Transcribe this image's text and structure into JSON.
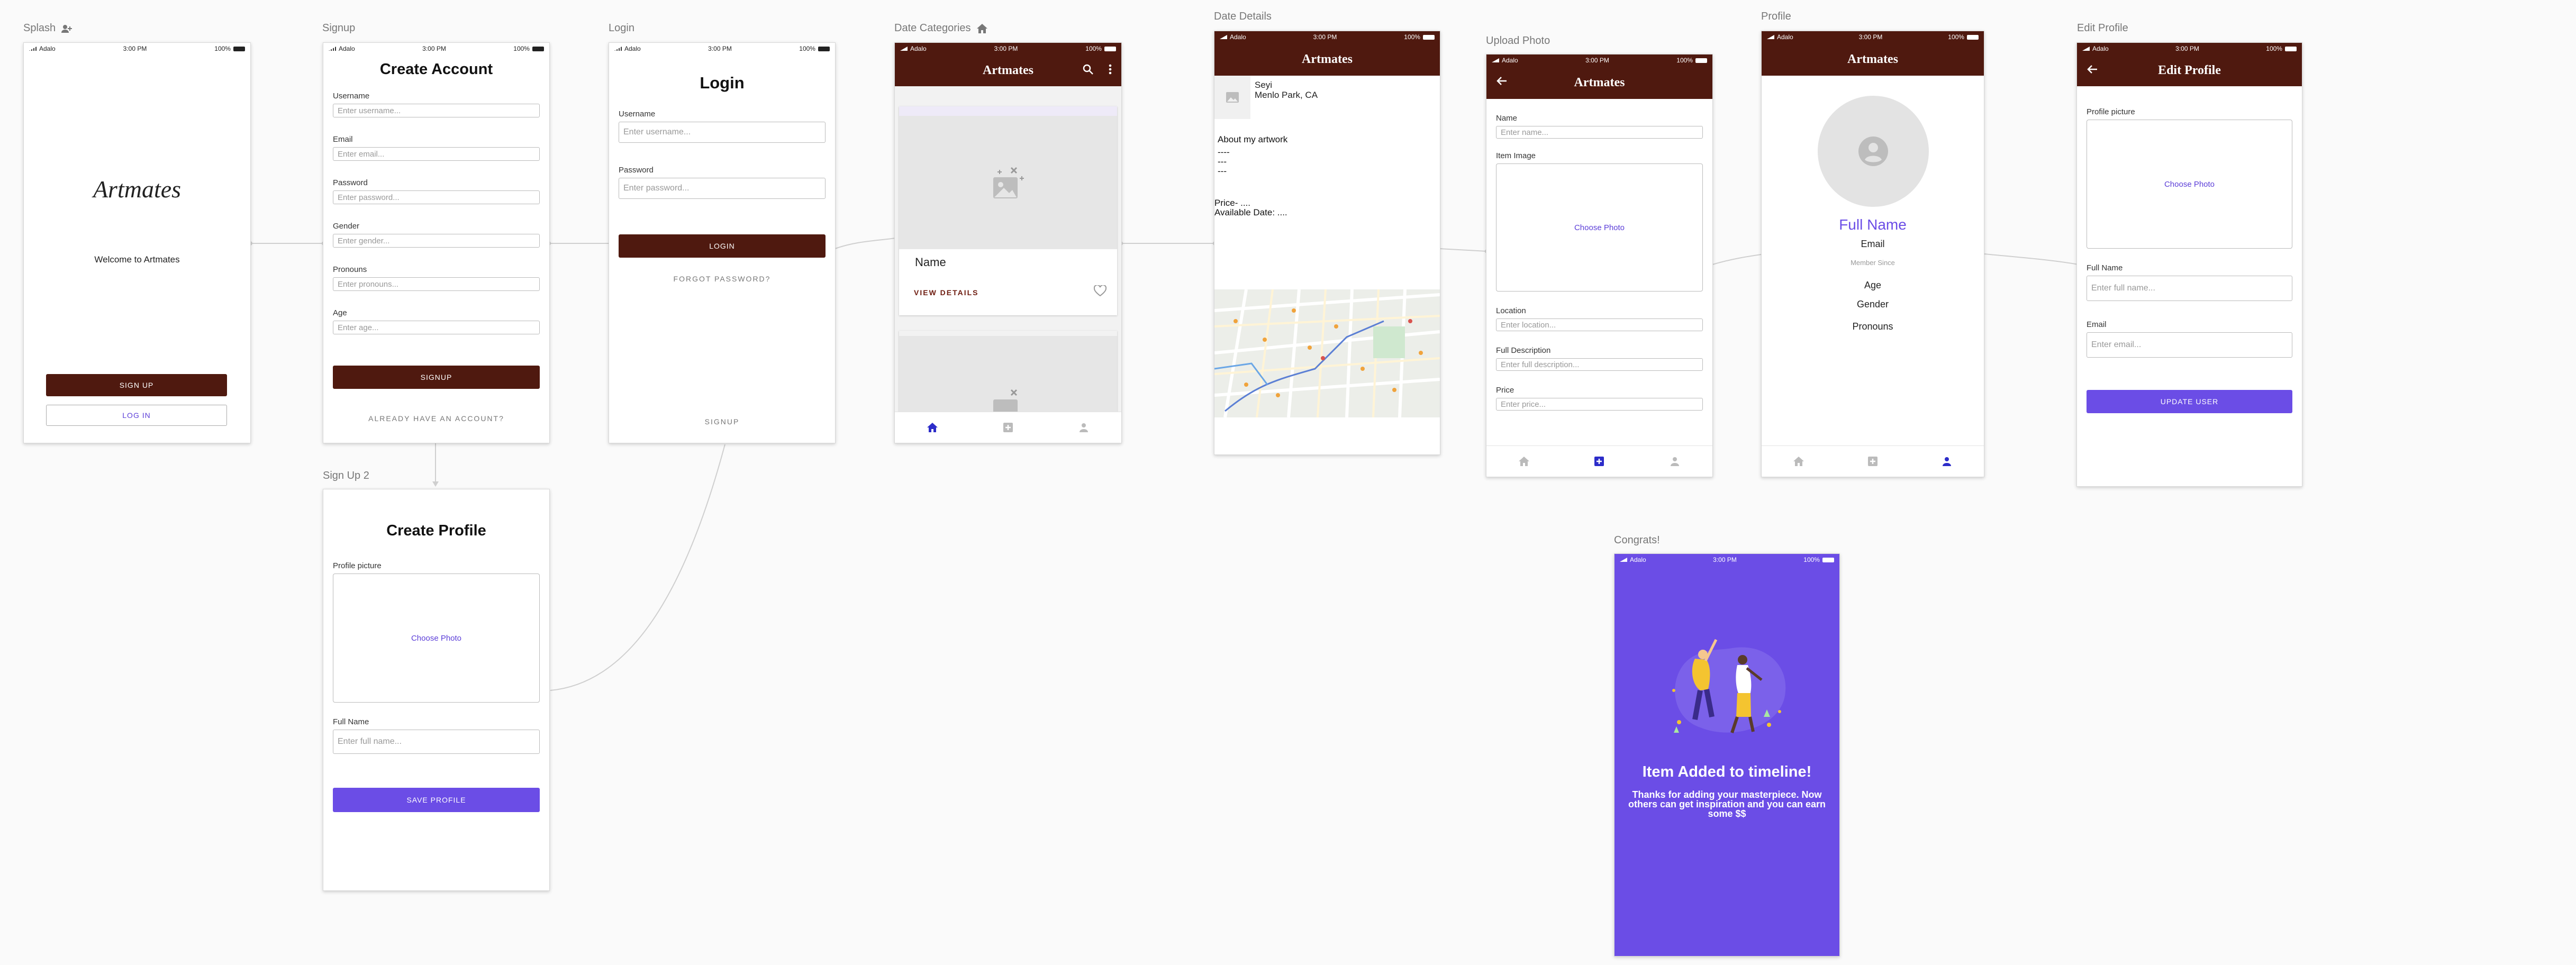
{
  "status_bar": {
    "carrier": "Adalo",
    "time": "3:00 PM",
    "battery": "100%"
  },
  "app_title": "Artmates",
  "colors": {
    "brand": "#4f190f",
    "accent": "#6b4de6",
    "link": "#5b3dd8",
    "home_active": "#2c2cc9"
  },
  "labels": {
    "splash": "Splash",
    "signup": "Signup",
    "login": "Login",
    "date_categories": "Date Categories",
    "date_details": "Date Details",
    "upload_photo": "Upload Photo",
    "profile": "Profile",
    "edit_profile": "Edit Profile",
    "sign_up_2": "Sign Up 2",
    "congrats": "Congrats!"
  },
  "splash": {
    "logo_text": "Artmates",
    "welcome": "Welcome to Artmates",
    "sign_up": "SIGN UP",
    "log_in": "LOG IN"
  },
  "signup": {
    "title": "Create Account",
    "fields": [
      {
        "label": "Username",
        "placeholder": "Enter username..."
      },
      {
        "label": "Email",
        "placeholder": "Enter email..."
      },
      {
        "label": "Password",
        "placeholder": "Enter password..."
      },
      {
        "label": "Gender",
        "placeholder": "Enter gender..."
      },
      {
        "label": "Pronouns",
        "placeholder": "Enter pronouns..."
      },
      {
        "label": "Age",
        "placeholder": "Enter age..."
      }
    ],
    "button": "SIGNUP",
    "link": "ALREADY HAVE AN ACCOUNT?"
  },
  "login": {
    "title": "Login",
    "fields": [
      {
        "label": "Username",
        "placeholder": "Enter username..."
      },
      {
        "label": "Password",
        "placeholder": "Enter password..."
      }
    ],
    "button": "LOGIN",
    "forgot": "FORGOT PASSWORD?",
    "signup": "SIGNUP"
  },
  "date_categories": {
    "card_name": "Name",
    "view_details": "VIEW DETAILS"
  },
  "date_details": {
    "user_name": "Seyi",
    "user_location": "Menlo Park, CA",
    "about": "About my artwork",
    "dashes": [
      "----",
      "---",
      "---"
    ],
    "price": "Price- ....",
    "available": "Available Date: ...."
  },
  "upload_photo": {
    "name_label": "Name",
    "name_placeholder": "Enter name...",
    "image_label": "Item Image",
    "choose_photo": "Choose Photo",
    "location_label": "Location",
    "location_placeholder": "Enter location...",
    "description_label": "Full Description",
    "description_placeholder": "Enter full description...",
    "price_label": "Price",
    "price_placeholder": "Enter price..."
  },
  "profile": {
    "full_name": "Full Name",
    "email": "Email",
    "member_since": "Member Since",
    "age": "Age",
    "gender": "Gender",
    "pronouns": "Pronouns"
  },
  "edit_profile": {
    "title": "Edit Profile",
    "picture_label": "Profile picture",
    "choose_photo": "Choose Photo",
    "full_name_label": "Full Name",
    "full_name_placeholder": "Enter full name...",
    "email_label": "Email",
    "email_placeholder": "Enter email...",
    "button": "UPDATE USER"
  },
  "sign_up_2": {
    "title": "Create Profile",
    "picture_label": "Profile picture",
    "choose_photo": "Choose Photo",
    "full_name_label": "Full Name",
    "full_name_placeholder": "Enter full name...",
    "button": "SAVE PROFILE"
  },
  "congrats": {
    "title": "Item Added to timeline!",
    "message": "Thanks for adding your masterpiece. Now others can get inspiration and you can earn some $$"
  }
}
